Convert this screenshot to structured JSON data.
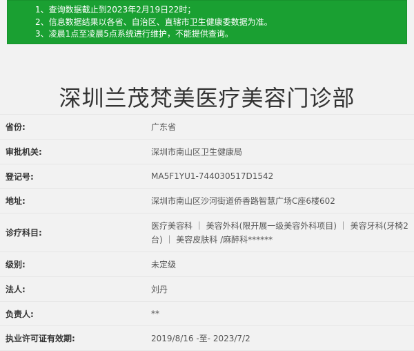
{
  "notice": {
    "lines": [
      "1、查询数据截止到2023年2月19日22时；",
      "2、信息数据结果以各省、自治区、直辖市卫生健康委数据为准。",
      "3、凌晨1点至凌晨5点系统进行维护，不能提供查询。"
    ]
  },
  "page": {
    "title": "深圳兰茂梵美医疗美容门诊部"
  },
  "details": [
    {
      "label": "省份:",
      "value": "广东省"
    },
    {
      "label": "审批机关:",
      "value": "深圳市南山区卫生健康局"
    },
    {
      "label": "登记号:",
      "value": "MA5F1YU1-744030517D1542"
    },
    {
      "label": "地址:",
      "value": "深圳市南山区沙河街道侨香路智慧广场C座6楼602"
    },
    {
      "label": "诊疗科目:",
      "value": "医疗美容科 ｜ 美容外科(限开展一级美容外科项目) ｜ 美容牙科(牙椅2台) ｜ 美容皮肤科 /麻醉科******"
    },
    {
      "label": "级别:",
      "value": "未定级"
    },
    {
      "label": "法人:",
      "value": "刘丹"
    },
    {
      "label": "负责人:",
      "value": "**"
    },
    {
      "label": "执业许可证有效期:",
      "value": "2019/8/16 -至- 2023/7/2"
    }
  ],
  "colors": {
    "notice_bg": "#1aa032",
    "page_bg": "#f2f2f2",
    "label_text": "#333333",
    "value_text": "#555555"
  }
}
